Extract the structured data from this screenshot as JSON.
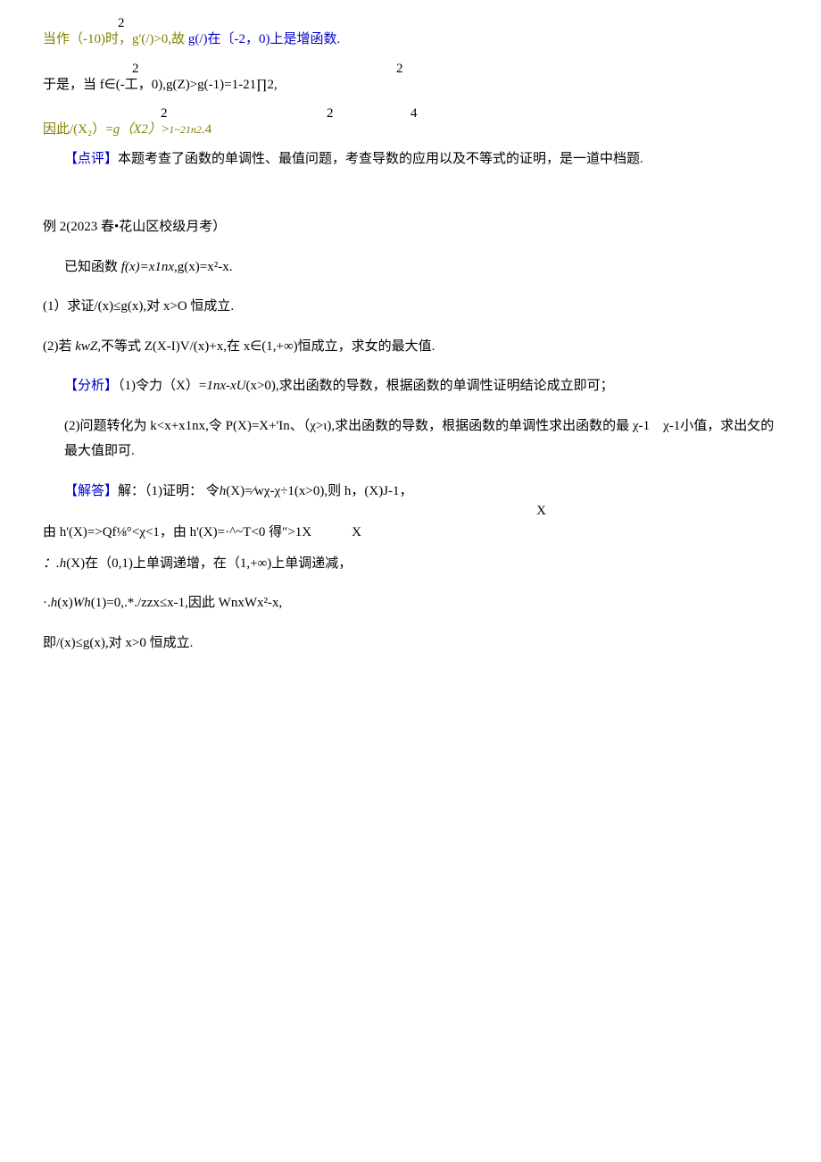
{
  "lines": {
    "l1_top": "2",
    "l1": {
      "a": "当作（-10)时，g'(/)>0,",
      "b": "故",
      "c": " g(/)在〔-2，0)上是增函数."
    },
    "l2_nums": {
      "left": "2",
      "right": "2"
    },
    "l3": "于是，当 f∈(-工，0),g(Z)>g(-1)=1-21∏2,",
    "l3_nums": {
      "a": "2",
      "b": "2",
      "c": "4"
    },
    "l4": {
      "a": "因此/(X₂）=",
      "b": "g（X2）",
      "c": ">",
      "d": "1~21n2",
      "e": ".4"
    },
    "l5": {
      "tag": "【点评】",
      "txt": "本题考查了函数的单调性、最值问题，考查导数的应用以及不等式的证明，是一道中档题."
    },
    "ex2": "例 2(2023 春•花山区校级月考）",
    "known": {
      "a": "已知函数 ",
      "b": "f(x)=x1nx",
      "c": ",g(x)=x²-x."
    },
    "q1": "(1）求证/(x)≤g(x),对 x>O 恒成立.",
    "q2": {
      "a": "(2)若 ",
      "b": "kwZ,",
      "c": "不等式 Z(X-I)V/(x)+x,在 x∈(1,+∞)恒成立，求女的最大值."
    },
    "an1": {
      "tag": "【分析】",
      "txt1": "（1)令力（X）=",
      "it": "1nx-xU",
      "txt2": "(x>0),求出函数的导数，根据函数的单调性证明结论成立即可；"
    },
    "an2": "(2)问题转化为 k<x+x1nx,令 P(X)=X+'In、（χ>ι),求出函数的导数，根据函数的单调性求出函数的最 χ-1　χ-1小值，求出攵的最大值即可.",
    "sol1": {
      "tag": "【解答】",
      "txt": "解：（1)证明： 令",
      "it": "h",
      "txt2": "(X)=∕wχ-χ÷1(x>0),则 h，(X)J-1，"
    },
    "sol1_sub": "X",
    "sol2": "由 h'(X)=>Qf⅛°<χ<1，由 h'(X)=·^~T<0 得″>1X　　　X",
    "sol3": {
      "a": "：.",
      "it": "h",
      "b": "(X)在（0,1)上单调递增，在（1,+∞)上单调递减，"
    },
    "sol4": {
      "a": "·.",
      "it": "h",
      "b": "(x)",
      "it2": "Wh",
      "c": "(1)=0,.*./zzx≤x-1,因此 WnxWx²-x,"
    },
    "sol5": "即/(x)≤g(x),对 x>0 恒成立."
  }
}
